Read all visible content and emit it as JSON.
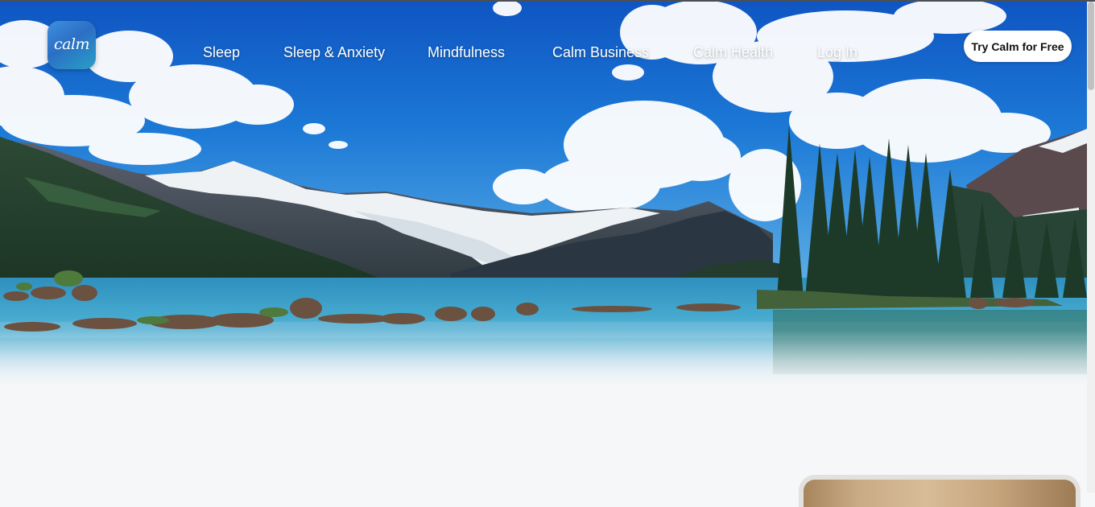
{
  "brand": {
    "logo_text": "calm",
    "logo_icon": "calm-logo-icon"
  },
  "nav": {
    "links": [
      "Sleep",
      "Sleep & Anxiety",
      "Mindfulness",
      "Calm Business",
      "Calm Health",
      "Log In"
    ],
    "cta_label": "Try Calm for Free"
  },
  "hero": {
    "image": "mountain-lake-landscape"
  },
  "colors": {
    "sky": "#1f6fd0",
    "lake": "#3aa6cc",
    "cta_bg": "#ffffff",
    "page_bg": "#f6f7f9"
  }
}
